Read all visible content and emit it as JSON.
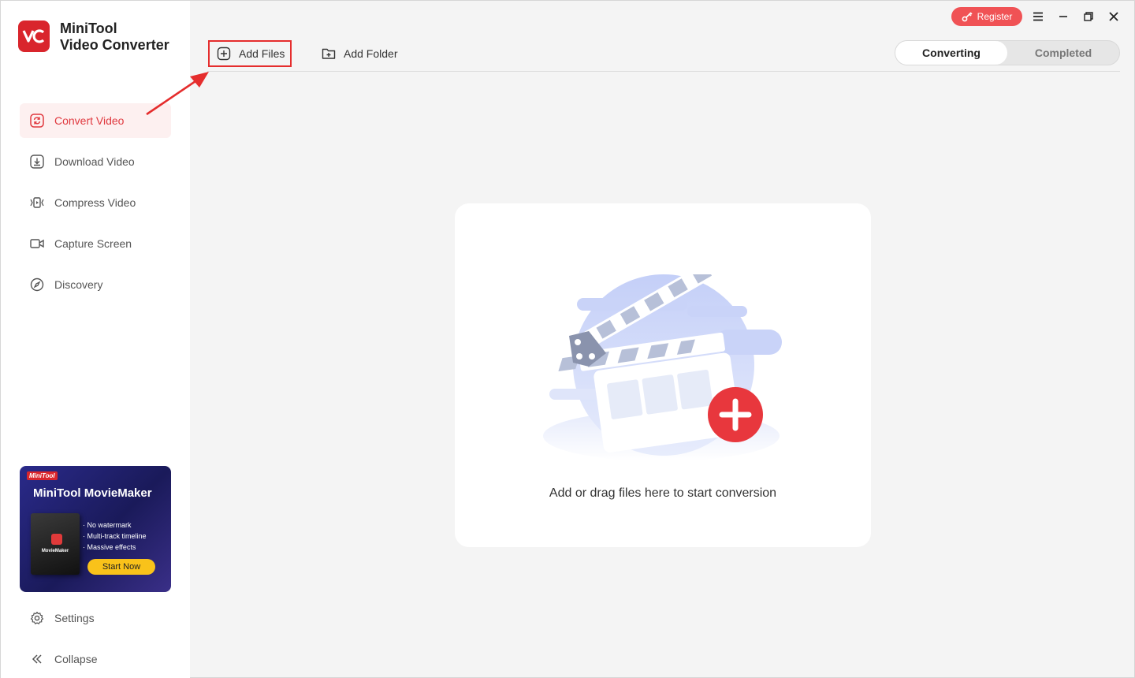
{
  "app": {
    "name_line1": "MiniTool",
    "name_line2": "Video Converter",
    "logo_icon": "vc-logo-icon"
  },
  "sidebar": {
    "items": [
      {
        "label": "Convert Video",
        "icon": "convert-icon",
        "active": true
      },
      {
        "label": "Download Video",
        "icon": "download-icon",
        "active": false
      },
      {
        "label": "Compress Video",
        "icon": "compress-icon",
        "active": false
      },
      {
        "label": "Capture Screen",
        "icon": "camera-icon",
        "active": false
      },
      {
        "label": "Discovery",
        "icon": "compass-icon",
        "active": false
      }
    ],
    "settings_label": "Settings",
    "collapse_label": "Collapse"
  },
  "promo": {
    "brand": "MiniTool",
    "title": "MiniTool MovieMaker",
    "box_label": "MovieMaker",
    "features": [
      "· No watermark",
      "· Multi-track timeline",
      "· Massive effects"
    ],
    "button": "Start Now"
  },
  "header": {
    "register_label": "Register",
    "add_files_label": "Add Files",
    "add_folder_label": "Add Folder",
    "tabs": [
      {
        "label": "Converting",
        "active": true
      },
      {
        "label": "Completed",
        "active": false
      }
    ]
  },
  "dropzone": {
    "hint": "Add or drag files here to start conversion"
  },
  "colors": {
    "accent": "#e0383e",
    "register": "#f05255",
    "highlight_border": "#e52d2d",
    "plus_circle": "#e8373d"
  }
}
